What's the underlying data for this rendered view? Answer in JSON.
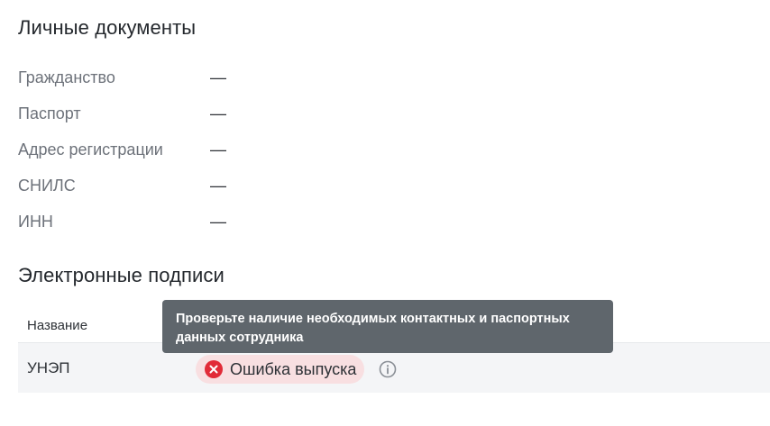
{
  "personal_documents": {
    "title": "Личные документы",
    "fields": [
      {
        "label": "Гражданство",
        "value": "—"
      },
      {
        "label": "Паспорт",
        "value": "—"
      },
      {
        "label": "Адрес регистрации",
        "value": "—"
      },
      {
        "label": "СНИЛС",
        "value": "—"
      },
      {
        "label": "ИНН",
        "value": "—"
      }
    ]
  },
  "electronic_signatures": {
    "title": "Электронные подписи",
    "table": {
      "columns": [
        "Название"
      ],
      "rows": [
        {
          "name": "УНЭП",
          "status": "Ошибка выпуска",
          "status_icon": "error-icon"
        }
      ]
    },
    "tooltip": "Проверьте наличие необходимых контактных и паспортных данных сотрудника"
  },
  "colors": {
    "error_red": "#e12b38",
    "error_badge_bg": "#f8dfe1",
    "tooltip_bg": "#5f666c",
    "row_bg": "#f4f5f7"
  }
}
